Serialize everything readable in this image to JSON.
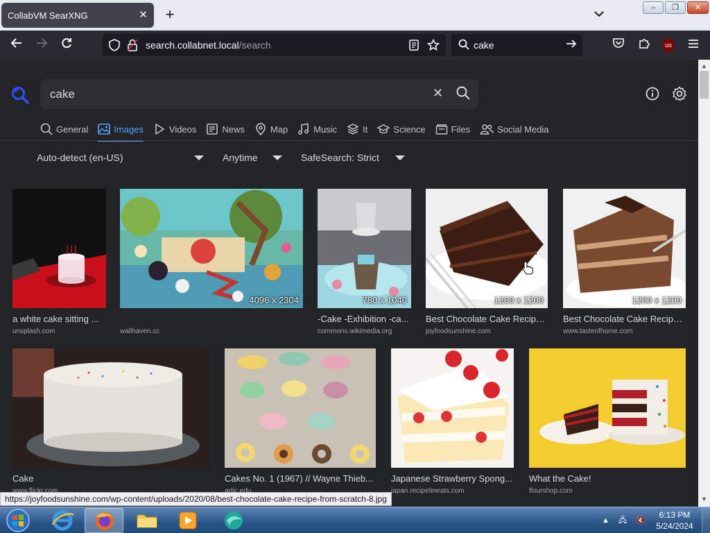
{
  "browser": {
    "tab_title": "CollabVM SearXNG",
    "url_host": "search.collabnet.local",
    "url_path": "/search",
    "search_box_value": "cake",
    "status_url": "https://joyfoodsunshine.com/wp-content/uploads/2020/08/best-chocolate-cake-recipe-from-scratch-8.jpg"
  },
  "query": {
    "value": "cake"
  },
  "categories": [
    {
      "label": "General",
      "icon": "search-icon"
    },
    {
      "label": "Images",
      "icon": "image-icon",
      "active": true
    },
    {
      "label": "Videos",
      "icon": "play-icon"
    },
    {
      "label": "News",
      "icon": "newspaper-icon"
    },
    {
      "label": "Map",
      "icon": "map-pin-icon"
    },
    {
      "label": "Music",
      "icon": "music-icon"
    },
    {
      "label": "It",
      "icon": "layers-icon"
    },
    {
      "label": "Science",
      "icon": "school-icon"
    },
    {
      "label": "Files",
      "icon": "files-icon"
    },
    {
      "label": "Social Media",
      "icon": "people-icon"
    }
  ],
  "filters": {
    "language": "Auto-detect (en-US)",
    "time": "Anytime",
    "safesearch": "SafeSearch: Strict"
  },
  "results": [
    {
      "title": "a white cake sitting ...",
      "source": "unsplash.com",
      "resolution": ""
    },
    {
      "title": "",
      "source": "wallhaven.cc",
      "resolution": "4096 x 2304"
    },
    {
      "title": "-Cake -Exhibition -ca...",
      "source": "commons.wikimedia.org",
      "resolution": "780 x 1040"
    },
    {
      "title": "Best Chocolate Cake Recipe...",
      "source": "joyfoodsunshine.com",
      "resolution": "1200 x 1200"
    },
    {
      "title": "Best Chocolate Cake Recipe...",
      "source": "www.tasteofhome.com",
      "resolution": "1200 x 1200"
    },
    {
      "title": "Cake",
      "source": "www.flickr.com",
      "resolution": ""
    },
    {
      "title": "Cakes No. 1 (1967) // Wayne Thieb...",
      "source": "artic.edu",
      "resolution": ""
    },
    {
      "title": "Japanese Strawberry Spong...",
      "source": "japan.recipetineats.com",
      "resolution": ""
    },
    {
      "title": "What the Cake!",
      "source": "flourshop.com",
      "resolution": ""
    }
  ],
  "taskbar": {
    "time": "6:13 PM",
    "date": "5/24/2024"
  },
  "colors": {
    "accent": "#58a6ff",
    "page_bg": "#222428",
    "taskbar": "#2b5586"
  }
}
